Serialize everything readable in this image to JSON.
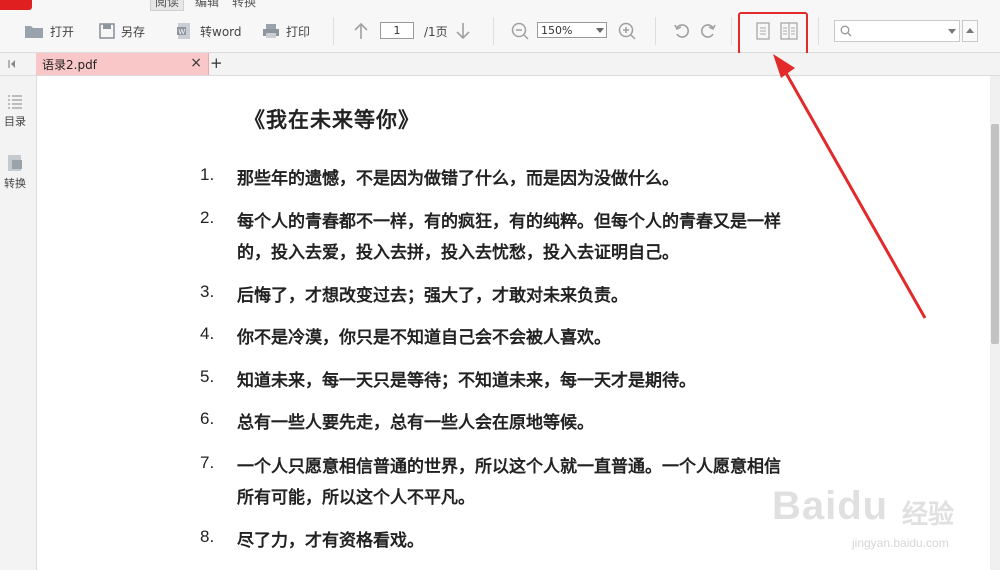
{
  "menu": {
    "tabs": [
      {
        "label": "阅读",
        "active": true
      },
      {
        "label": "编辑",
        "active": false
      },
      {
        "label": "转换",
        "active": false
      }
    ]
  },
  "toolbar": {
    "open_label": "打开",
    "save_as_label": "另存",
    "to_word_label": "转word",
    "print_label": "打印",
    "page_current": "1",
    "page_total": "/1页",
    "zoom": "150%"
  },
  "tabbar": {
    "doc_tab_label": "语录2.pdf",
    "close_glyph": "×",
    "new_tab_glyph": "+"
  },
  "side_panel": {
    "items": [
      {
        "label": "目录",
        "icon": "list-icon"
      },
      {
        "label": "转换",
        "icon": "convert-icon"
      }
    ]
  },
  "document": {
    "title": "《我在未来等你》",
    "items": [
      {
        "num": "1.",
        "lines": [
          "那些年的遗憾，不是因为做错了什么，而是因为没做什么。"
        ]
      },
      {
        "num": "2.",
        "lines": [
          "每个人的青春都不一样，有的疯狂，有的纯粹。但每个人的青春又是一样",
          "的，投入去爱，投入去拼，投入去忧愁，投入去证明自己。"
        ]
      },
      {
        "num": "3.",
        "lines": [
          "后悔了，才想改变过去；强大了，才敢对未来负责。"
        ]
      },
      {
        "num": "4.",
        "lines": [
          "你不是冷漠，你只是不知道自己会不会被人喜欢。"
        ]
      },
      {
        "num": "5.",
        "lines": [
          "知道未来，每一天只是等待；不知道未来，每一天才是期待。"
        ]
      },
      {
        "num": "6.",
        "lines": [
          "总有一些人要先走，总有一些人会在原地等候。"
        ]
      },
      {
        "num": "7.",
        "lines": [
          "一个人只愿意相信普通的世界，所以这个人就一直普通。一个人愿意相信",
          "所有可能，所以这个人不平凡。"
        ]
      },
      {
        "num": "8.",
        "lines": [
          "尽了力，才有资格看戏。"
        ]
      }
    ]
  },
  "watermark": {
    "brand": "Baidu",
    "brand_cn": "经验",
    "url": "jingyan.baidu.com"
  },
  "colors": {
    "accent_red": "#e32a2a",
    "tab_pink": "#f9c7c7"
  }
}
